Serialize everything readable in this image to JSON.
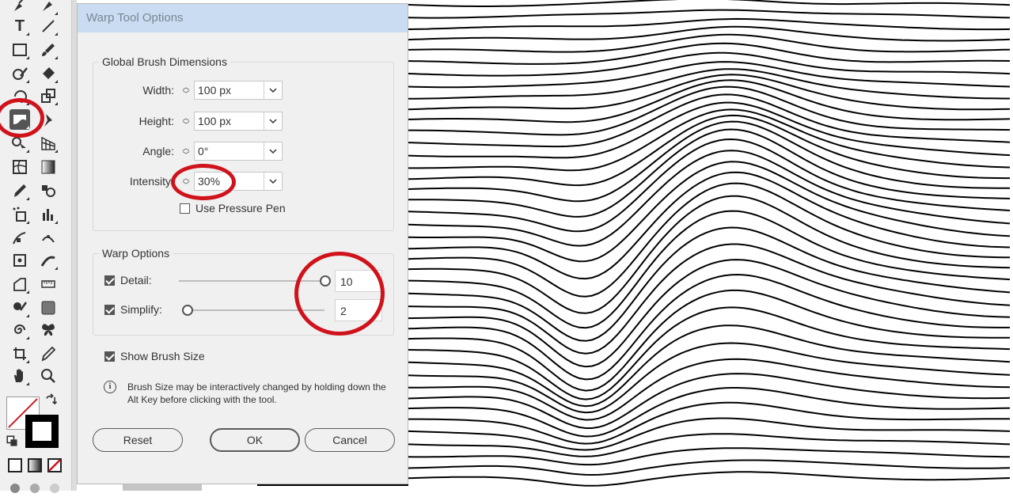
{
  "dialog": {
    "title": "Warp Tool Options",
    "global_brush": {
      "legend": "Global Brush Dimensions",
      "width": {
        "label": "Width:",
        "value": "100 px"
      },
      "height": {
        "label": "Height:",
        "value": "100 px"
      },
      "angle": {
        "label": "Angle:",
        "value": "0°"
      },
      "intensity": {
        "label": "Intensity",
        "value": "30%"
      },
      "pressure_pen": {
        "label": "Use Pressure Pen",
        "checked": false
      }
    },
    "warp_options": {
      "legend": "Warp Options",
      "detail": {
        "label": "Detail:",
        "value": "10",
        "checked": true,
        "level": 1.0
      },
      "simplify": {
        "label": "Simplify:",
        "value": "2",
        "checked": true,
        "level": 0.0
      }
    },
    "show_brush_size": {
      "label": "Show Brush Size",
      "checked": true
    },
    "info_line1": "Brush Size may be interactively changed by holding down the",
    "info_line2": "Alt Key before clicking with the tool.",
    "buttons": {
      "reset": "Reset",
      "ok": "OK",
      "cancel": "Cancel"
    }
  },
  "toolbar": {
    "type_tool_glyph": "T",
    "tools": [
      "pen-icon",
      "brush-pen-icon",
      "type-icon",
      "line-segment-icon",
      "rectangle-icon",
      "paintbrush-icon",
      "shaper-icon",
      "eraser-icon",
      "rotate-icon",
      "scale-icon",
      "warp-icon",
      "puppet-warp-icon",
      "shape-builder-icon",
      "perspective-grid-icon",
      "mesh-icon",
      "gradient-icon",
      "eyedropper-icon",
      "blend-icon",
      "symbol-sprayer-icon",
      "column-graph-icon",
      "artboard-icon",
      "slice-icon",
      "hand-icon",
      "zoom-icon"
    ],
    "active_tool": "warp-icon"
  },
  "colors": {
    "accent_annotation": "#d0121b",
    "titlebar": "#c9dcf1",
    "panel": "#f0f0f0"
  }
}
